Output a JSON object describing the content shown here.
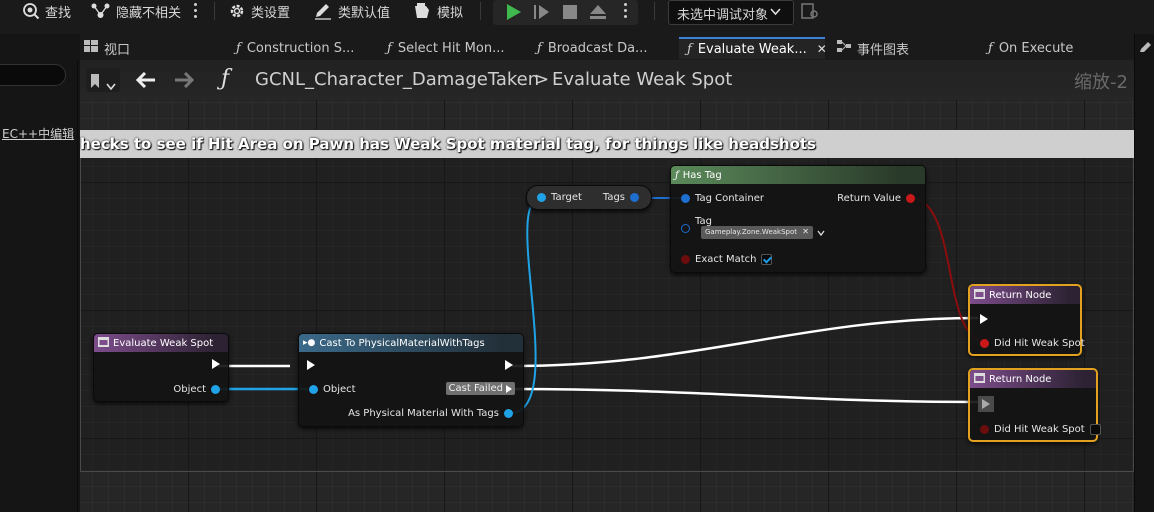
{
  "toolbar": {
    "find_label": "查找",
    "hide_unrelated_label": "隐藏不相关",
    "class_settings_label": "类设置",
    "class_defaults_label": "类默认值",
    "simulate_label": "模拟",
    "debug_object_label": "未选中调试对象"
  },
  "tabs": [
    {
      "label": "视口",
      "icon": "viewport-icon"
    },
    {
      "label": "Construction S...",
      "icon": "function-icon"
    },
    {
      "label": "Select Hit Mon...",
      "icon": "function-icon"
    },
    {
      "label": "Broadcast Da...",
      "icon": "function-icon"
    },
    {
      "label": "Evaluate Weak...",
      "icon": "function-icon",
      "active": true
    },
    {
      "label": "事件图表",
      "icon": "event-graph-icon"
    },
    {
      "label": "On Execute",
      "icon": "function-icon"
    }
  ],
  "left_panel": {
    "link_text": "EC++中编辑"
  },
  "breadcrumb": {
    "blueprint": "GCNL_Character_DamageTaken",
    "separator": ">",
    "function": "Evaluate Weak Spot",
    "zoom": "缩放-2"
  },
  "comment": {
    "title": "hecks to see if Hit Area on Pawn has Weak Spot material tag, for things like headshots"
  },
  "nodes": {
    "entry": {
      "title": "Evaluate Weak Spot",
      "object_pin": "Object"
    },
    "cast": {
      "title": "Cast To PhysicalMaterialWithTags",
      "object_pin": "Object",
      "cast_failed": "Cast Failed",
      "out_pin": "As Physical Material With Tags"
    },
    "break": {
      "target": "Target",
      "tags": "Tags"
    },
    "has_tag": {
      "title": "Has Tag",
      "tag_container": "Tag Container",
      "return_value": "Return Value",
      "tag_label": "Tag",
      "tag_value": "Gameplay.Zone.WeakSpot",
      "exact_match": "Exact Match",
      "exact_match_checked": true
    },
    "return_true": {
      "title": "Return Node",
      "pin": "Did Hit Weak Spot",
      "value": true
    },
    "return_false": {
      "title": "Return Node",
      "pin": "Did Hit Weak Spot",
      "value": false
    }
  },
  "colors": {
    "accent_tab": "#3b82d6",
    "selected_node": "#e2a21f",
    "exec_wire": "#ffffff",
    "object_wire": "#1fa3e6",
    "bool_wire": "#8b0d0d"
  }
}
